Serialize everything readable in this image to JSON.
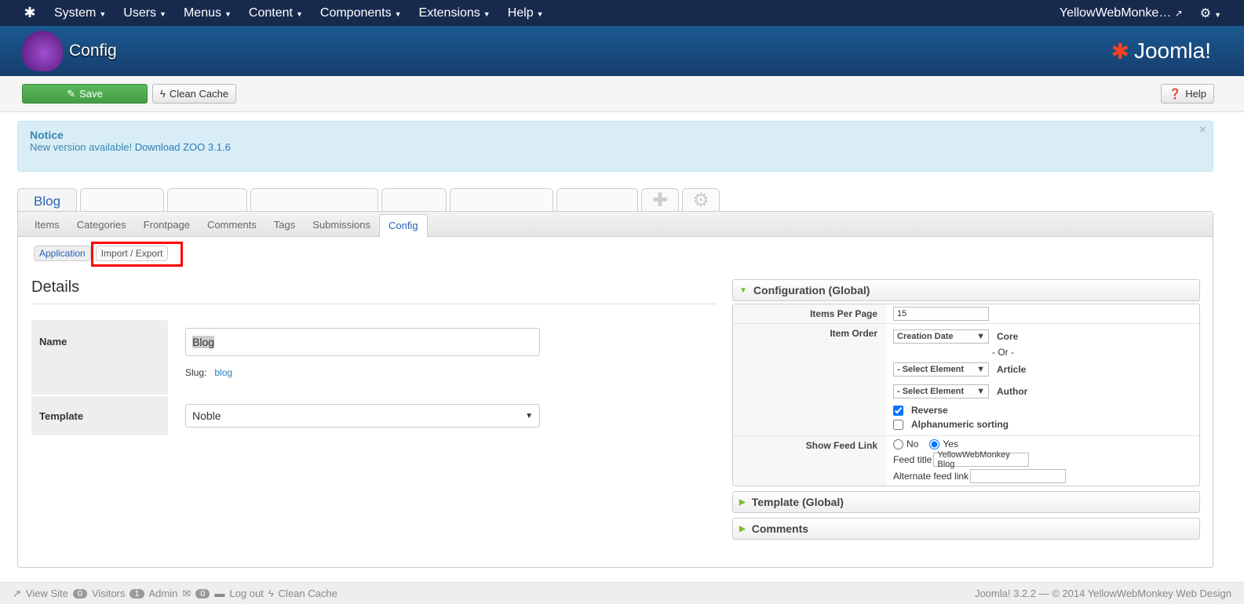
{
  "topnav": {
    "menus": [
      "System",
      "Users",
      "Menus",
      "Content",
      "Components",
      "Extensions",
      "Help"
    ],
    "site": "YellowWebMonke…"
  },
  "header": {
    "title": "Config",
    "brand": "Joomla!"
  },
  "toolbar": {
    "save": "Save",
    "clean_cache": "Clean Cache",
    "help": "Help"
  },
  "notice": {
    "title": "Notice",
    "text": "New version available! ",
    "link": "Download ZOO 3.1.6"
  },
  "app_tabs": {
    "active": "Blog"
  },
  "subnav": [
    "Items",
    "Categories",
    "Frontpage",
    "Comments",
    "Tags",
    "Submissions",
    "Config"
  ],
  "pills": [
    "Application",
    "Import / Export"
  ],
  "details": {
    "heading": "Details",
    "name_label": "Name",
    "name_value": "Blog",
    "slug_label": "Slug:",
    "slug": "blog",
    "template_label": "Template",
    "template_value": "Noble"
  },
  "config": {
    "heading": "Configuration (Global)",
    "items_per_page_label": "Items Per Page",
    "items_per_page": "15",
    "item_order_label": "Item Order",
    "order_core": "Creation Date",
    "core": "Core",
    "or": "- Or -",
    "order_article": "- Select Element",
    "article": "Article",
    "order_author": "- Select Element",
    "author": "Author",
    "reverse": "Reverse",
    "reverse_checked": true,
    "alpha": "Alphanumeric sorting",
    "alpha_checked": false,
    "feed_label": "Show Feed Link",
    "no": "No",
    "yes": "Yes",
    "feed_selected": "Yes",
    "feed_title_label": "Feed title",
    "feed_title": "YellowWebMonkey Blog",
    "alt_feed_label": "Alternate feed link",
    "alt_feed": ""
  },
  "template_heading": "Template (Global)",
  "comments_heading": "Comments",
  "footer": {
    "view_site": "View Site",
    "visitors_count": "0",
    "visitors": "Visitors",
    "admin_count": "1",
    "admin": "Admin",
    "msg_count": "0",
    "logout": "Log out",
    "clean_cache": "Clean Cache",
    "version": "Joomla! 3.2.2 — © 2014 YellowWebMonkey Web Design"
  }
}
